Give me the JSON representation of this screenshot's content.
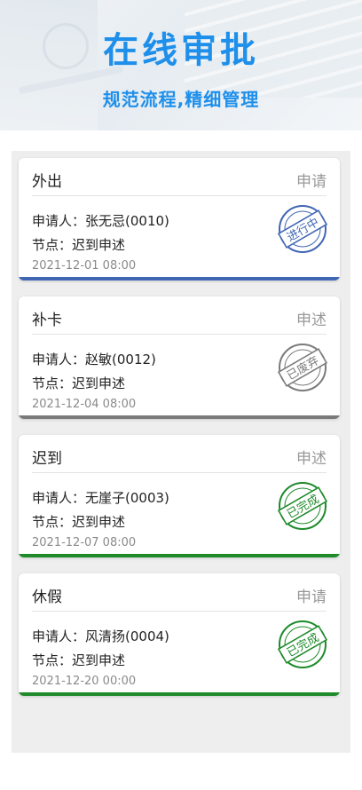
{
  "hero": {
    "title": "在线审批",
    "subtitle": "规范流程,精细管理"
  },
  "labels": {
    "applicant": "申请人：",
    "node": "节点："
  },
  "cards": [
    {
      "type": "外出",
      "action": "申请",
      "applicant": "张无忌(0010)",
      "node": "迟到申述",
      "date": "2021-12-01 08:00",
      "status": "进行中",
      "color": "#4066b4"
    },
    {
      "type": "补卡",
      "action": "申述",
      "applicant": "赵敏(0012)",
      "node": "迟到申述",
      "date": "2021-12-04 08:00",
      "status": "已废弃",
      "color": "#7a7a7a"
    },
    {
      "type": "迟到",
      "action": "申述",
      "applicant": "无崖子(0003)",
      "node": "迟到申述",
      "date": "2021-12-07 08:00",
      "status": "已完成",
      "color": "#1e8a2a"
    },
    {
      "type": "休假",
      "action": "申请",
      "applicant": "风清扬(0004)",
      "node": "迟到申述",
      "date": "2021-12-20 00:00",
      "status": "已完成",
      "color": "#1e8a2a"
    }
  ]
}
